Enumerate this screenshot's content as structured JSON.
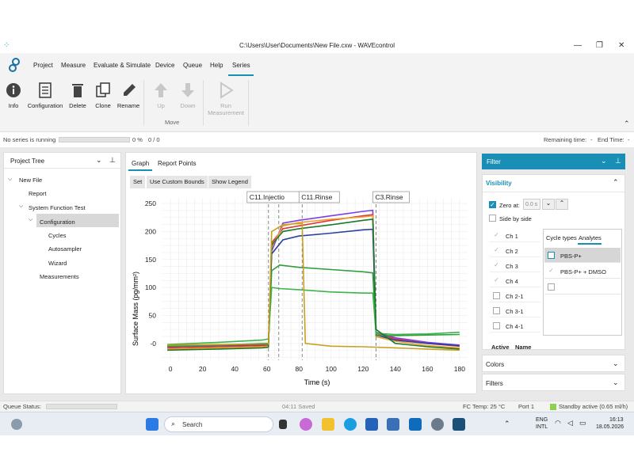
{
  "window": {
    "title": "C:\\Users\\User\\Documents\\New File.cxw - WAVEcontrol"
  },
  "menu": {
    "items": [
      "Project",
      "Measure",
      "Evaluate & Simulate",
      "Device",
      "Queue",
      "Help",
      "Series"
    ],
    "active": "Series"
  },
  "ribbon": {
    "info": "Info",
    "configuration": "Configuration",
    "delete": "Delete",
    "clone": "Clone",
    "rename": "Rename",
    "up": "Up",
    "down": "Down",
    "move_group": "Move",
    "run_1": "Run",
    "run_2": "Measurement"
  },
  "status": {
    "left": "No series is running",
    "progress": "0 %",
    "count": "0  /  0",
    "remaining_label": "Remaining time:",
    "remaining_value": "-",
    "end_label": "End Time:",
    "end_value": "-"
  },
  "project_tree": {
    "title": "Project Tree",
    "items": [
      {
        "label": "New File"
      },
      {
        "label": "Report"
      },
      {
        "label": "System Function Test"
      },
      {
        "label": "Configuration"
      },
      {
        "label": "Cycles"
      },
      {
        "label": "Autosampler"
      },
      {
        "label": "Wizard"
      },
      {
        "label": "Measurements"
      }
    ]
  },
  "graph_tabs": {
    "graph": "Graph",
    "report_points": "Report Points"
  },
  "graph_toolbar": {
    "set": "Set",
    "custom_bounds": "Use Custom Bounds",
    "legend": "Show Legend"
  },
  "chart_data": {
    "type": "line",
    "xlabel": "Time (s)",
    "ylabel": "Surface Mass (pg/mm²)",
    "xlim": [
      -5,
      185
    ],
    "ylim": [
      -30,
      260
    ],
    "x_ticks": [
      0,
      20,
      40,
      60,
      80,
      100,
      120,
      140,
      160,
      180
    ],
    "y_ticks": [
      0,
      50,
      100,
      150,
      200,
      250
    ],
    "y_tick_labels": [
      "-0",
      "50",
      "100",
      "150",
      "200",
      "250"
    ],
    "grid": true,
    "markers": [
      {
        "label": "C11.Injectio",
        "x": 61
      },
      {
        "label": "C11.Rinse",
        "x": 82
      },
      {
        "label": "C3.Rinse",
        "x": 128
      }
    ],
    "series": [
      {
        "color": "#7b3fe4",
        "x": [
          -2,
          30,
          57,
          61,
          63,
          70,
          80,
          100,
          120,
          126,
          128,
          140,
          160,
          180
        ],
        "y": [
          -6,
          -4,
          -2,
          -2,
          165,
          215,
          220,
          228,
          236,
          238,
          20,
          10,
          2,
          -3
        ]
      },
      {
        "color": "#d93a3a",
        "x": [
          -2,
          30,
          57,
          61,
          63,
          70,
          80,
          100,
          120,
          126,
          128,
          140,
          160,
          180
        ],
        "y": [
          -8,
          -6,
          -4,
          -3,
          180,
          205,
          210,
          220,
          228,
          230,
          18,
          8,
          0,
          -5
        ]
      },
      {
        "color": "#f0a030",
        "x": [
          -2,
          30,
          57,
          61,
          63,
          70,
          80,
          100,
          120,
          126,
          128,
          140,
          160,
          180
        ],
        "y": [
          -10,
          -8,
          -6,
          -5,
          172,
          210,
          216,
          222,
          226,
          228,
          12,
          4,
          -4,
          -8
        ]
      },
      {
        "color": "#2a3fa0",
        "x": [
          -2,
          30,
          57,
          61,
          63,
          70,
          80,
          100,
          120,
          126,
          128,
          140,
          160,
          180
        ],
        "y": [
          -4,
          -3,
          -2,
          -2,
          160,
          185,
          192,
          197,
          203,
          204,
          15,
          6,
          0,
          -4
        ]
      },
      {
        "color": "#2e9e3a",
        "x": [
          -2,
          30,
          57,
          61,
          63,
          68,
          80,
          100,
          120,
          126,
          128,
          140,
          160,
          180
        ],
        "y": [
          -5,
          -3,
          0,
          0,
          130,
          140,
          136,
          132,
          128,
          126,
          14,
          14,
          15,
          16
        ]
      },
      {
        "color": "#3cb44b",
        "x": [
          -2,
          30,
          57,
          61,
          63,
          68,
          80,
          100,
          120,
          126,
          128,
          140,
          160,
          180
        ],
        "y": [
          -2,
          2,
          6,
          8,
          100,
          98,
          96,
          92,
          90,
          90,
          18,
          16,
          17,
          20
        ]
      },
      {
        "color": "#1a7a2a",
        "x": [
          -2,
          30,
          57,
          61,
          63,
          70,
          80,
          100,
          120,
          126,
          128,
          140,
          160,
          180
        ],
        "y": [
          -12,
          -10,
          -8,
          -7,
          176,
          200,
          205,
          212,
          220,
          222,
          25,
          0,
          -6,
          -10
        ]
      },
      {
        "color": "#c8a020",
        "x": [
          -2,
          30,
          57,
          61,
          63,
          70,
          78,
          82,
          84,
          100,
          120,
          140,
          160,
          180
        ],
        "y": [
          -3,
          -2,
          -1,
          -1,
          200,
          212,
          214,
          214,
          0,
          -5,
          -6,
          -8,
          -10,
          -12
        ]
      }
    ]
  },
  "filter": {
    "title": "Filter",
    "visibility": "Visibility",
    "zero_at_label": "Zero at:",
    "zero_at_value": "0.0 s",
    "side_by_side": "Side by side",
    "channels": [
      {
        "label": "Ch 1",
        "checked": true
      },
      {
        "label": "Ch 2",
        "checked": true
      },
      {
        "label": "Ch 3",
        "checked": true
      },
      {
        "label": "Ch 4",
        "checked": true
      },
      {
        "label": "Ch 2-1",
        "checked": false
      },
      {
        "label": "Ch 3-1",
        "checked": false
      },
      {
        "label": "Ch 4-1",
        "checked": false
      }
    ],
    "tab_cycle_types": "Cycle types",
    "tab_analytes": "Analytes",
    "analytes": [
      {
        "label": "PBS-P+",
        "checked": false,
        "selected": true
      },
      {
        "label": "PBS-P+ + DMSO",
        "checked": true,
        "selected": false
      },
      {
        "label": "",
        "checked": false,
        "selected": false
      }
    ],
    "col_active": "Active",
    "col_name": "Name",
    "colors": "Colors",
    "filters": "Filters"
  },
  "bottom_status": {
    "queue": "Queue Status:",
    "saved": "04:11 Saved",
    "fc_temp": "FC Temp: 25 °C",
    "port": "Port 1",
    "standby": "Standby active (0.65 ml/h)"
  },
  "taskbar": {
    "search": "Search",
    "lang1": "ENG",
    "lang2": "INTL",
    "time": "16:13",
    "date": "18.05.2026"
  }
}
